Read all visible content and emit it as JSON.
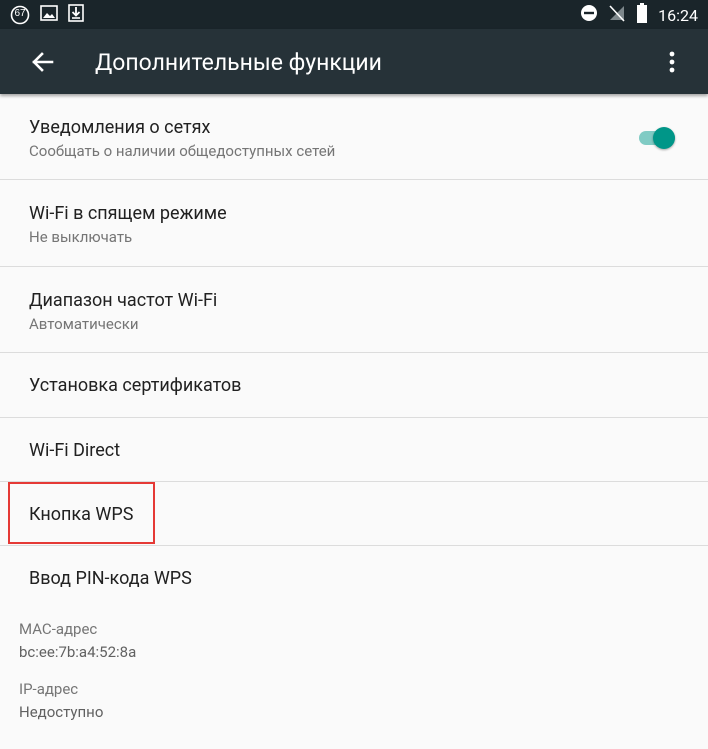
{
  "status_bar": {
    "left_icons": [
      "badge-67-icon",
      "image-icon",
      "download-icon"
    ],
    "badge_text": "67",
    "right_icons": [
      "do-not-disturb-icon",
      "no-signal-icon",
      "battery-icon"
    ],
    "time": "16:24"
  },
  "toolbar": {
    "title": "Дополнительные функции",
    "back_icon": "arrow-back-icon",
    "overflow_icon": "more-vert-icon",
    "color": "#263238"
  },
  "settings": {
    "network_notifications": {
      "title": "Уведомления о сетях",
      "subtitle": "Сообщать о наличии общедоступных сетей",
      "switch_on": true
    },
    "wifi_sleep": {
      "title": "Wi-Fi в спящем режиме",
      "subtitle": "Не выключать"
    },
    "wifi_band": {
      "title": "Диапазон частот Wi-Fi",
      "subtitle": "Автоматически"
    },
    "install_certs": {
      "title": "Установка сертификатов"
    },
    "wifi_direct": {
      "title": "Wi-Fi Direct"
    },
    "wps_button": {
      "title": "Кнопка WPS",
      "highlighted": true
    },
    "wps_pin": {
      "title": "Ввод PIN-кода WPS"
    }
  },
  "info": {
    "mac_label": "MAC-адрес",
    "mac_value": "bc:ee:7b:a4:52:8a",
    "ip_label": "IP-адрес",
    "ip_value": "Недоступно"
  },
  "colors": {
    "accent": "#009688",
    "highlight": "#e53935"
  }
}
